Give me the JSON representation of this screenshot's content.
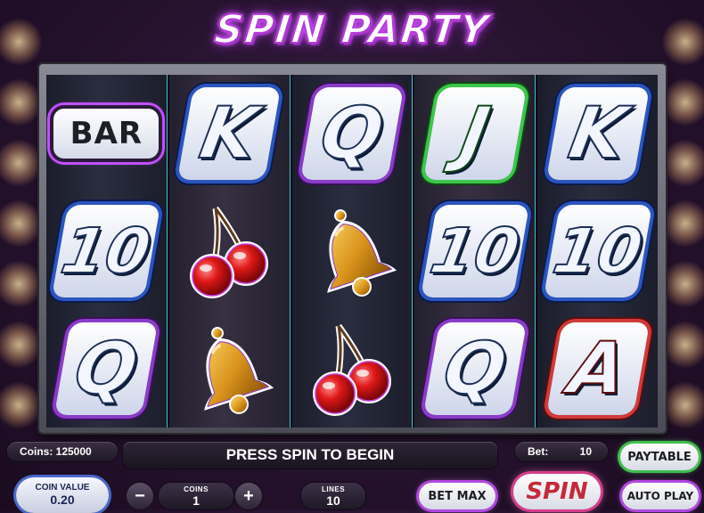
{
  "game": {
    "title": "SPIN PARTY",
    "accent": "#c24fff"
  },
  "reels": [
    {
      "symbols": [
        "BAR",
        "10",
        "Q"
      ]
    },
    {
      "symbols": [
        "K",
        "cherries",
        "bell"
      ]
    },
    {
      "symbols": [
        "Q",
        "bell",
        "cherries"
      ]
    },
    {
      "symbols": [
        "J",
        "10",
        "Q"
      ]
    },
    {
      "symbols": [
        "K",
        "10",
        "A"
      ]
    }
  ],
  "status": {
    "coins_label": "Coins: 125000",
    "message": "PRESS SPIN TO BEGIN",
    "bet_label": "Bet:",
    "bet_value": "10"
  },
  "controls": {
    "paytable": "PAYTABLE",
    "coin_value_label": "COIN VALUE",
    "coin_value": "0.20",
    "minus": "−",
    "coins_label": "COINS",
    "coins_value": "1",
    "plus": "+",
    "lines_label": "LINES",
    "lines_value": "10",
    "bet_max": "BET MAX",
    "spin": "SPIN",
    "auto_play": "AUTO PLAY"
  }
}
